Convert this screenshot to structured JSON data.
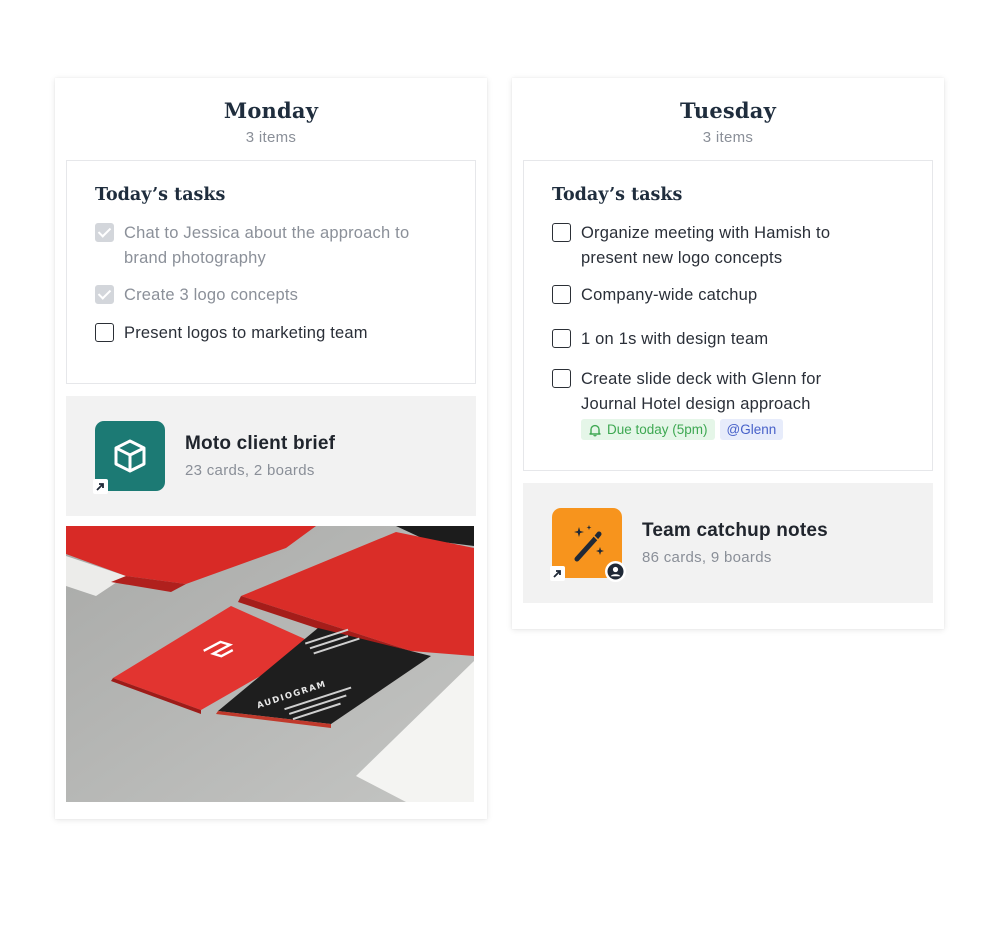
{
  "monday": {
    "title": "Monday",
    "count": "3 items",
    "tasks_title": "Today’s tasks",
    "tasks": [
      {
        "text": "Chat to Jessica about the approach to brand photography",
        "done": true
      },
      {
        "text": "Create 3 logo concepts",
        "done": true
      },
      {
        "text": "Present logos to marketing team",
        "done": false
      }
    ],
    "board": {
      "title": "Moto client brief",
      "meta": "23 cards, 2 boards",
      "icon": "cube-icon",
      "color": "#1c7a74"
    },
    "image": {
      "brand_text": "AUDIOGRAM"
    }
  },
  "tuesday": {
    "title": "Tuesday",
    "count": "3 items",
    "tasks_title": "Today’s tasks",
    "tasks": [
      {
        "text": "Organize meeting with Hamish to present new logo concepts",
        "done": false
      },
      {
        "text": "Company-wide catchup",
        "done": false
      },
      {
        "text": "1 on 1s with design team",
        "done": false
      },
      {
        "text": "Create slide deck with Glenn for Journal Hotel design approach",
        "done": false
      }
    ],
    "tags": {
      "due": "Due today (5pm)",
      "mention": "@Glenn"
    },
    "board": {
      "title": "Team catchup notes",
      "meta": "86 cards, 9 boards",
      "icon": "magic-wand-icon",
      "color": "#f7941d"
    }
  },
  "colors": {
    "due_green": "#3ea852",
    "mention_blue": "#4761c9",
    "accent_red": "#d8312c"
  }
}
